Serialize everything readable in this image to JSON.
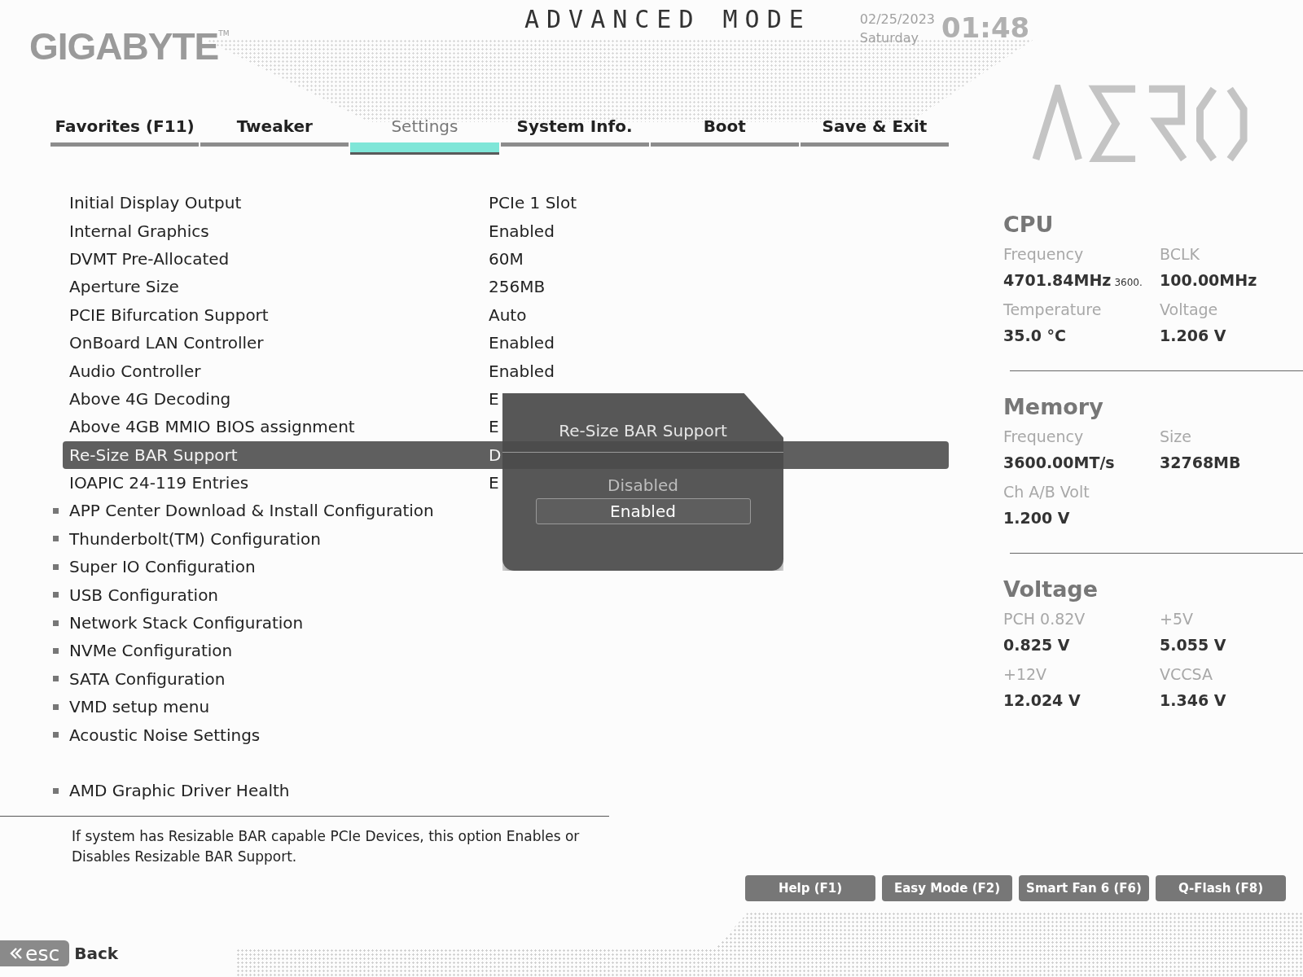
{
  "brand": {
    "logo": "GIGABYTE",
    "trademark": "TM"
  },
  "mode_title": "ADVANCED MODE",
  "clock": {
    "date": "02/25/2023",
    "day": "Saturday",
    "time": "01:48"
  },
  "tabs": [
    {
      "label": "Favorites (F11)",
      "selected": false
    },
    {
      "label": "Tweaker",
      "selected": false
    },
    {
      "label": "Settings",
      "selected": true
    },
    {
      "label": "System Info.",
      "selected": false
    },
    {
      "label": "Boot",
      "selected": false
    },
    {
      "label": "Save & Exit",
      "selected": false
    }
  ],
  "settings": [
    {
      "kind": "option",
      "label": "Initial Display Output",
      "value": "PCIe 1 Slot",
      "selected": false
    },
    {
      "kind": "option",
      "label": "Internal Graphics",
      "value": "Enabled",
      "selected": false
    },
    {
      "kind": "option",
      "label": "DVMT Pre-Allocated",
      "value": "60M",
      "selected": false
    },
    {
      "kind": "option",
      "label": "Aperture Size",
      "value": "256MB",
      "selected": false
    },
    {
      "kind": "option",
      "label": "PCIE Bifurcation Support",
      "value": "Auto",
      "selected": false
    },
    {
      "kind": "option",
      "label": "OnBoard LAN Controller",
      "value": "Enabled",
      "selected": false
    },
    {
      "kind": "option",
      "label": "Audio Controller",
      "value": "Enabled",
      "selected": false
    },
    {
      "kind": "option",
      "label": "Above 4G Decoding",
      "value": "E",
      "selected": false
    },
    {
      "kind": "option",
      "label": "Above 4GB MMIO BIOS assignment",
      "value": "E",
      "selected": false
    },
    {
      "kind": "option",
      "label": "Re-Size BAR Support",
      "value": "D",
      "selected": true
    },
    {
      "kind": "option",
      "label": "IOAPIC 24-119 Entries",
      "value": "E",
      "selected": false
    },
    {
      "kind": "submenu",
      "label": "APP Center Download & Install Configuration",
      "selected": false
    },
    {
      "kind": "submenu",
      "label": "Thunderbolt(TM) Configuration",
      "selected": false
    },
    {
      "kind": "submenu",
      "label": "Super IO Configuration",
      "selected": false
    },
    {
      "kind": "submenu",
      "label": "USB Configuration",
      "selected": false
    },
    {
      "kind": "submenu",
      "label": "Network Stack Configuration",
      "selected": false
    },
    {
      "kind": "submenu",
      "label": "NVMe Configuration",
      "selected": false
    },
    {
      "kind": "submenu",
      "label": "SATA Configuration",
      "selected": false
    },
    {
      "kind": "submenu",
      "label": "VMD setup menu",
      "selected": false
    },
    {
      "kind": "submenu",
      "label": "Acoustic Noise Settings",
      "selected": false
    },
    {
      "kind": "spacer"
    },
    {
      "kind": "submenu",
      "label": "AMD Graphic Driver Health",
      "selected": false
    }
  ],
  "popup": {
    "title": "Re-Size BAR Support",
    "options": [
      {
        "label": "Disabled",
        "selected": false
      },
      {
        "label": "Enabled",
        "selected": true
      }
    ]
  },
  "monitor": [
    {
      "title": "CPU",
      "fields": [
        {
          "label": "Frequency",
          "value": "4701.84MHz",
          "note": "3600."
        },
        {
          "label": "BCLK",
          "value": "100.00MHz"
        },
        {
          "label": "Temperature",
          "value": "35.0 °C"
        },
        {
          "label": "Voltage",
          "value": "1.206 V"
        }
      ]
    },
    {
      "title": "Memory",
      "fields": [
        {
          "label": "Frequency",
          "value": "3600.00MT/s"
        },
        {
          "label": "Size",
          "value": "32768MB"
        },
        {
          "label": "Ch A/B Volt",
          "value": "1.200 V"
        }
      ]
    },
    {
      "title": "Voltage",
      "fields": [
        {
          "label": "PCH 0.82V",
          "value": "0.825 V"
        },
        {
          "label": "+5V",
          "value": "5.055 V"
        },
        {
          "label": "+12V",
          "value": "12.024 V"
        },
        {
          "label": "VCCSA",
          "value": "1.346 V"
        }
      ]
    }
  ],
  "help_text": "If system has Resizable BAR capable PCIe Devices, this option Enables or Disables Resizable BAR Support.",
  "function_buttons": [
    "Help (F1)",
    "Easy Mode (F2)",
    "Smart Fan 6 (F6)",
    "Q-Flash (F8)"
  ],
  "back": {
    "key": "esc",
    "label": "Back"
  }
}
